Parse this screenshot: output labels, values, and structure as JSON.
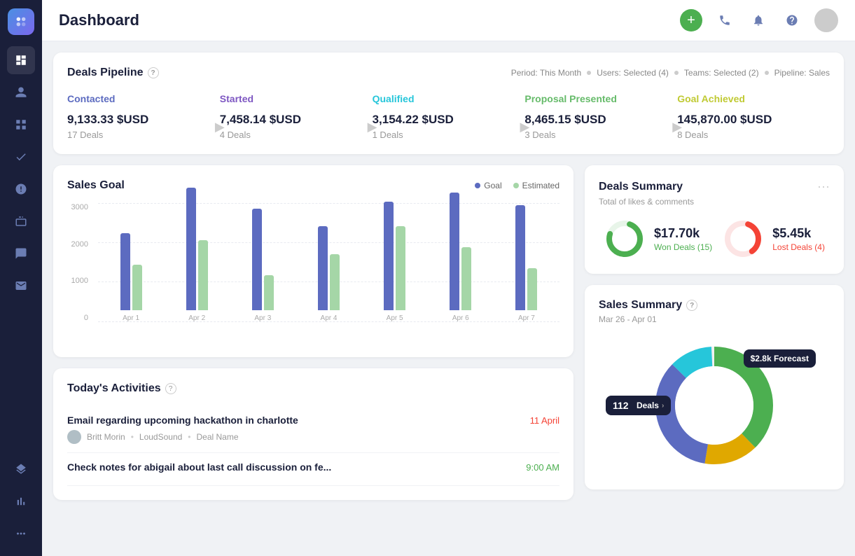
{
  "header": {
    "title": "Dashboard"
  },
  "sidebar": {
    "items": [
      {
        "name": "dashboard-icon",
        "icon": "⊙",
        "active": true
      },
      {
        "name": "user-icon",
        "icon": "👤"
      },
      {
        "name": "grid-icon",
        "icon": "▦"
      },
      {
        "name": "check-icon",
        "icon": "✓"
      },
      {
        "name": "dollar-icon",
        "icon": "$"
      },
      {
        "name": "box-icon",
        "icon": "⬡"
      },
      {
        "name": "chat-icon",
        "icon": "💬"
      },
      {
        "name": "mail-icon",
        "icon": "✉"
      },
      {
        "name": "layers-icon",
        "icon": "⧉"
      },
      {
        "name": "bar-icon",
        "icon": "▮"
      },
      {
        "name": "more-icon",
        "icon": "···"
      }
    ]
  },
  "pipeline": {
    "title": "Deals Pipeline",
    "filters": {
      "period": "Period: This Month",
      "users": "Users: Selected (4)",
      "teams": "Teams: Selected (2)",
      "pipeline": "Pipeline: Sales"
    },
    "stages": [
      {
        "name": "Contacted",
        "color": "#5c6bc0",
        "amount": "9,133.33 $USD",
        "deals": "17 Deals"
      },
      {
        "name": "Started",
        "color": "#7e57c2",
        "amount": "7,458.14 $USD",
        "deals": "4 Deals"
      },
      {
        "name": "Qualified",
        "color": "#26c6da",
        "amount": "3,154.22 $USD",
        "deals": "1 Deals"
      },
      {
        "name": "Proposal Presented",
        "color": "#66bb6a",
        "amount": "8,465.15 $USD",
        "deals": "3 Deals"
      },
      {
        "name": "Goal Achieved",
        "color": "#d4e157",
        "amount": "145,870.00 $USD",
        "deals": "8 Deals"
      }
    ]
  },
  "sales_goal": {
    "title": "Sales Goal",
    "legend": {
      "goal_label": "Goal",
      "goal_color": "#5c6bc0",
      "estimated_label": "Estimated",
      "estimated_color": "#a5d6a7"
    },
    "y_labels": [
      "3000",
      "2000",
      "1000",
      "0"
    ],
    "bars": [
      {
        "label": "Apr 1",
        "goal_height": 110,
        "est_height": 65
      },
      {
        "label": "Apr 2",
        "goal_height": 175,
        "est_height": 100
      },
      {
        "label": "Apr 3",
        "goal_height": 145,
        "est_height": 50
      },
      {
        "label": "Apr 4",
        "goal_height": 120,
        "est_height": 80
      },
      {
        "label": "Apr 5",
        "goal_height": 155,
        "est_height": 120
      },
      {
        "label": "Apr 6",
        "goal_height": 168,
        "est_height": 90
      },
      {
        "label": "Apr 7",
        "goal_height": 150,
        "est_height": 60
      }
    ]
  },
  "deals_summary": {
    "title": "Deals Summary",
    "subtitle": "Total of likes & comments",
    "won": {
      "amount": "$17.70k",
      "label": "Won Deals (15)",
      "color": "#4caf50",
      "pct": 75
    },
    "lost": {
      "amount": "$5.45k",
      "label": "Lost Deals (4)",
      "color": "#f44336",
      "pct": 35
    }
  },
  "sales_summary": {
    "title": "Sales Summary",
    "period": "Mar 26 - Apr 01",
    "deals_count": "112",
    "deals_label": "Deals",
    "forecast_prefix": "$2.8k",
    "forecast_label": "Forecast",
    "segments": [
      {
        "color": "#4caf50",
        "pct": 38
      },
      {
        "color": "#e0a800",
        "pct": 15
      },
      {
        "color": "#5c6bc0",
        "pct": 35
      },
      {
        "color": "#26c6da",
        "pct": 12
      }
    ]
  },
  "activities": {
    "title": "Today's Activities",
    "items": [
      {
        "name": "Email regarding upcoming hackathon in charlotte",
        "date": "11 April",
        "date_color": "red",
        "person": "Britt Morin",
        "company": "LoudSound",
        "deal": "Deal Name"
      },
      {
        "name": "Check notes for abigail about last call discussion on fe...",
        "date": "9:00 AM",
        "date_color": "green",
        "person": "",
        "company": "",
        "deal": ""
      }
    ]
  }
}
